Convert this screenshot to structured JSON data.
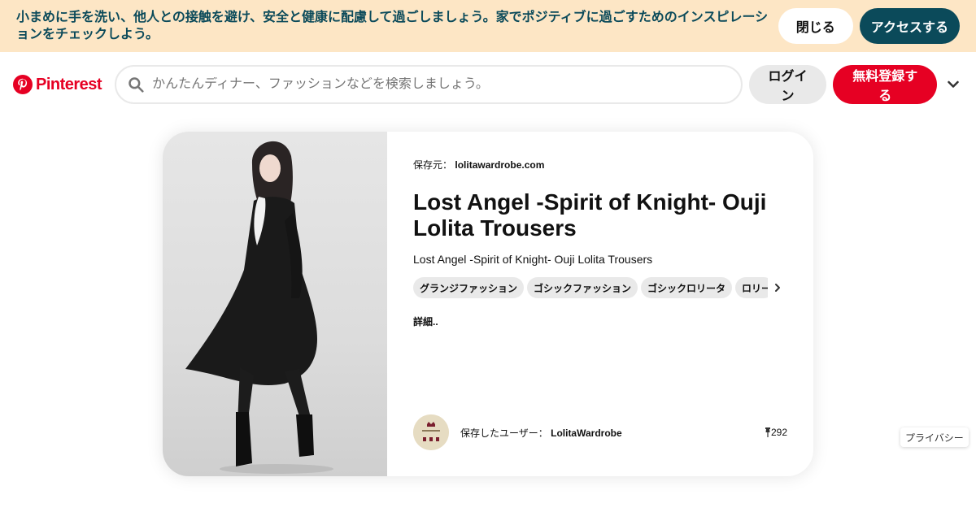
{
  "banner": {
    "text": "小まめに手を洗い、他人との接触を避け、安全と健康に配慮して過ごしましょう。家でポジティブに過ごすためのインスピレーションをチェックしよう。",
    "close_label": "閉じる",
    "access_label": "アクセスする"
  },
  "header": {
    "logo_text": "Pinterest",
    "search_placeholder": "かんたんディナー、ファッションなどを検索しましょう。",
    "login_label": "ログイン",
    "signup_label": "無料登録する"
  },
  "pin": {
    "source_prefix": "保存元：",
    "source_domain": "lolitawardrobe.com",
    "title": "Lost Angel -Spirit of Knight- Ouji Lolita Trousers",
    "description": "Lost Angel -Spirit of Knight- Ouji Lolita Trousers",
    "tags": [
      "グランジファッション",
      "ゴシックファッション",
      "ゴシックロリータ",
      "ロリータ"
    ],
    "more_label": "詳細..",
    "saved_by_prefix": "保存したユーザー：",
    "saved_by_user": "LolitaWardrobe",
    "pin_count": "292"
  },
  "footer": {
    "privacy_label": "プライバシー"
  },
  "colors": {
    "brand": "#e60023",
    "banner_bg": "#fde6c5",
    "banner_text": "#0b4a5a",
    "button_grey": "#e9e9e9"
  },
  "icons": [
    "pinterest-logo-icon",
    "search-icon",
    "chevron-down-icon",
    "chevron-right-icon",
    "pin-icon"
  ]
}
